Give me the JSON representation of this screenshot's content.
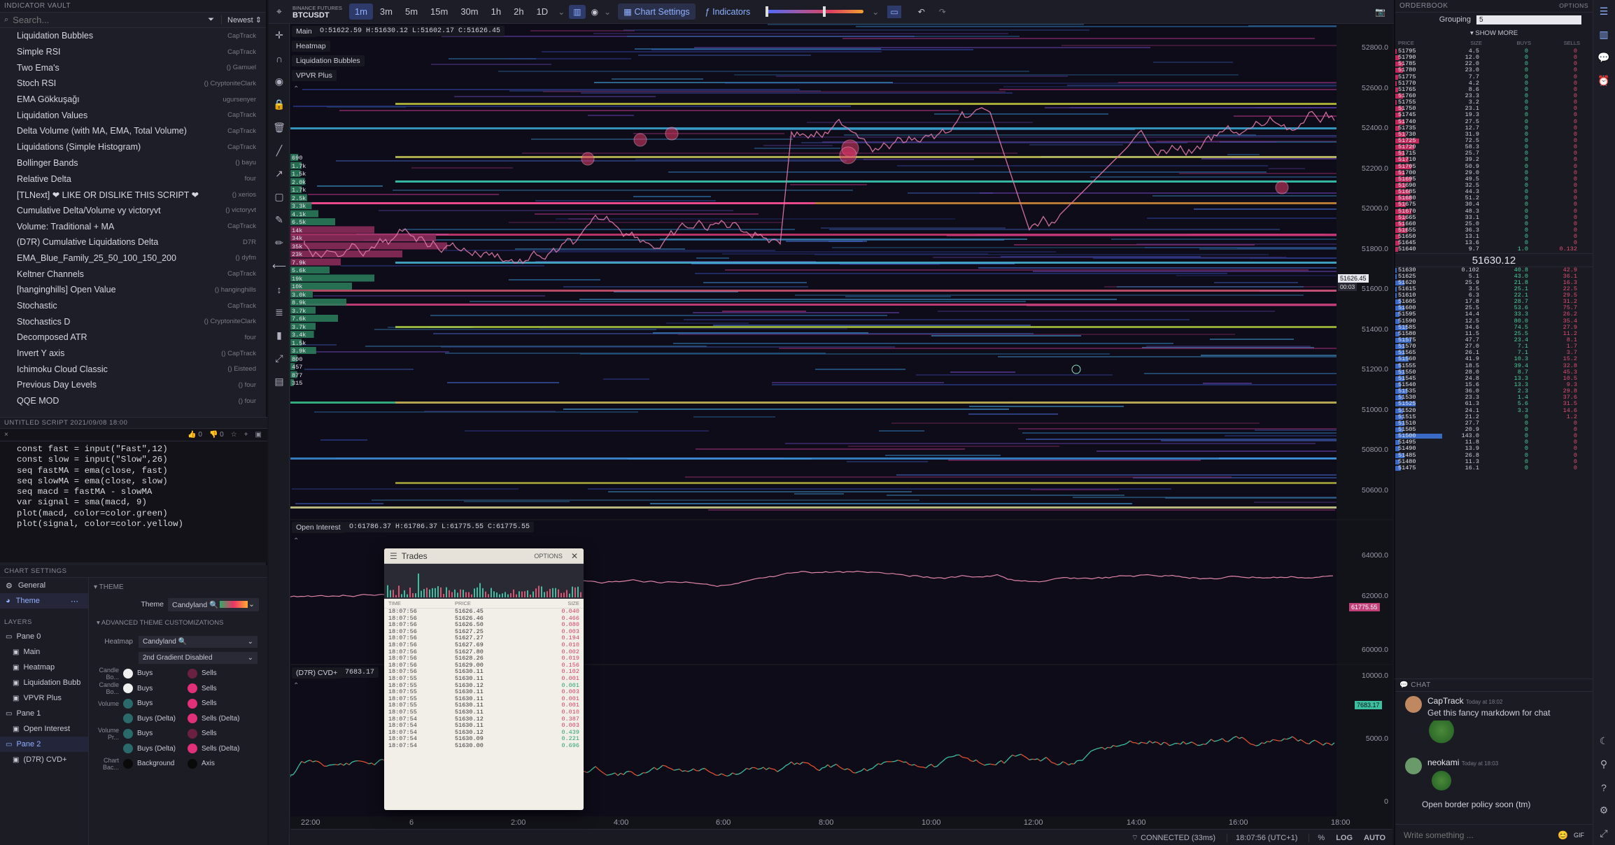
{
  "vault": {
    "title": "INDICATOR VAULT",
    "search_placeholder": "Search...",
    "sort": "Newest",
    "items": [
      {
        "name": "Liquidation Bubbles",
        "author": "CapTrack"
      },
      {
        "name": "Simple RSI",
        "author": "CapTrack"
      },
      {
        "name": "Two Ema's",
        "author": "() Gamuel"
      },
      {
        "name": "Stoch RSI",
        "author": "() CryptoniteClark"
      },
      {
        "name": "EMA Gökkuşağı",
        "author": "ugursenyer"
      },
      {
        "name": "Liquidation Values",
        "author": "CapTrack"
      },
      {
        "name": "Delta Volume (with MA, EMA, Total Volume)",
        "author": "CapTrack"
      },
      {
        "name": "Liquidations (Simple Histogram)",
        "author": "CapTrack"
      },
      {
        "name": "Bollinger Bands",
        "author": "() bayu"
      },
      {
        "name": "Relative Delta",
        "author": "four"
      },
      {
        "name": "[TLNext] ❤ LIKE OR DISLIKE THIS SCRIPT ❤",
        "author": "() xerios"
      },
      {
        "name": "Cumulative Delta/Volume vy victoryvt",
        "author": "() victoryvt"
      },
      {
        "name": "Volume: Traditional + MA",
        "author": "CapTrack"
      },
      {
        "name": "(D7R) Cumulative Liquidations Delta",
        "author": "D7R"
      },
      {
        "name": "EMA_Blue_Family_25_50_100_150_200",
        "author": "() dyfm"
      },
      {
        "name": "Keltner Channels",
        "author": "CapTrack"
      },
      {
        "name": "[hanginghills] Open Value",
        "author": "() hanginghills"
      },
      {
        "name": "Stochastic",
        "author": "CapTrack"
      },
      {
        "name": "Stochastics D",
        "author": "() CryptoniteClark"
      },
      {
        "name": "Decomposed ATR",
        "author": "four"
      },
      {
        "name": "Invert Y axis",
        "author": "() CapTrack"
      },
      {
        "name": "Ichimoku Cloud Classic",
        "author": "() Eisteed"
      },
      {
        "name": "Previous Day Levels",
        "author": "() four"
      },
      {
        "name": "QQE MOD",
        "author": "() four"
      }
    ]
  },
  "editor": {
    "title": "UNTITLED SCRIPT 2021/09/08 18:00",
    "likes": "0",
    "dislikes": "0",
    "lines": [
      "const fast = input(\"Fast\",12)",
      "const slow = input(\"Slow\",26)",
      "",
      "seq fastMA = ema(close, fast)",
      "seq slowMA = ema(close, slow)",
      "",
      "seq macd = fastMA - slowMA",
      "var signal = sma(macd, 9)",
      "",
      "plot(macd, color=color.green)",
      "plot(signal, color=color.yellow)"
    ]
  },
  "settings": {
    "title": "CHART SETTINGS",
    "nav": [
      "General",
      "Theme"
    ],
    "layers_title": "LAYERS",
    "layers": [
      {
        "label": "Pane 0",
        "indent": 0
      },
      {
        "label": "Main",
        "indent": 1
      },
      {
        "label": "Heatmap",
        "indent": 1
      },
      {
        "label": "Liquidation Bubb",
        "indent": 1
      },
      {
        "label": "VPVR Plus",
        "indent": 1
      },
      {
        "label": "Pane 1",
        "indent": 0
      },
      {
        "label": "Open Interest",
        "indent": 1
      },
      {
        "label": "Pane 2",
        "indent": 0
      },
      {
        "label": "(D7R) CVD+",
        "indent": 1
      }
    ],
    "theme_section": "THEME",
    "theme_label": "Theme",
    "theme_value": "Candyland 🔍",
    "adv_section": "ADVANCED THEME CUSTOMIZATIONS",
    "heatmap_label": "Heatmap",
    "heatmap_value": "Candyland 🔍",
    "gradient_value": "2nd Gradient Disabled",
    "rows": [
      {
        "label": "Candle Bo...",
        "a": "Buys",
        "ac": "#f0f0f0",
        "b": "Sells",
        "bc": "#6a2040"
      },
      {
        "label": "Candle Bo...",
        "a": "Buys",
        "ac": "#f0f0f0",
        "b": "Sells",
        "bc": "#e0307a"
      },
      {
        "label": "Volume",
        "a": "Buys",
        "ac": "#2a6a6a",
        "b": "Sells",
        "bc": "#e0307a"
      },
      {
        "label": "",
        "a": "Buys (Delta)",
        "ac": "#2a6a6a",
        "b": "Sells (Delta)",
        "bc": "#e0307a"
      },
      {
        "label": "Volume Pr...",
        "a": "Buys",
        "ac": "#2a6a6a",
        "b": "Sells",
        "bc": "#6a2040"
      },
      {
        "label": "",
        "a": "Buys (Delta)",
        "ac": "#2a6a6a",
        "b": "Sells (Delta)",
        "bc": "#e0307a"
      },
      {
        "label": "Chart Bac...",
        "a": "Background",
        "ac": "#0a0a0a",
        "b": "Axis",
        "bc": "#0a0a0a"
      }
    ]
  },
  "toolbar": {
    "exchange": "BINANCE FUTURES",
    "symbol": "BTCUSDT",
    "timeframes": [
      "1m",
      "3m",
      "5m",
      "15m",
      "30m",
      "1h",
      "2h",
      "1D"
    ],
    "active_tf": "1m",
    "chart_settings": "Chart Settings",
    "indicators": "Indicators"
  },
  "chart": {
    "main_tag": "Main",
    "ohlc": "O:51622.59 H:51630.12 L:51602.17 C:51626.45",
    "overlays": [
      "Heatmap",
      "Liquidation Bubbles",
      "VPVR Plus"
    ],
    "price_labels": [
      "52800.0",
      "52600.0",
      "52400.0",
      "52200.0",
      "52000.0",
      "51800.0",
      "51600.0",
      "51400.0",
      "51200.0",
      "51000.0",
      "50800.0",
      "50600.0"
    ],
    "price_tag": "51626.45",
    "price_tag_sub": "00:03",
    "vpvr_labels": [
      "690",
      "1.7k",
      "1.5k",
      "2.0k",
      "1.7k",
      "2.5k",
      "3.3k",
      "4.1k",
      "6.5k",
      "14k",
      "34k",
      "35k",
      "23k",
      "7.9k",
      "5.6k",
      "19k",
      "10k",
      "3.0k",
      "8.9k",
      "3.7k",
      "7.6k",
      "3.7k",
      "3.4k",
      "1.5k",
      "3.9k",
      "800",
      "457",
      "877",
      "315"
    ]
  },
  "oi": {
    "label": "Open Interest",
    "ohlc": "O:61786.37 H:61786.37 L:61775.55 C:61775.55",
    "labels": [
      "64000.0",
      "62000.0",
      "60000.0"
    ],
    "tag": "61775.55"
  },
  "cvd": {
    "label": "(D7R) CVD+",
    "value": "7683.17",
    "labels": [
      "10000.0",
      "5000.0",
      "0"
    ],
    "tag": "7683.17"
  },
  "xaxis": [
    "22:00",
    "6",
    "2:00",
    "4:00",
    "6:00",
    "8:00",
    "10:00",
    "12:00",
    "14:00",
    "16:00",
    "18:00"
  ],
  "status": {
    "connected": "CONNECTED (33ms)",
    "time": "18:07:56 (UTC+1)",
    "pct": "%",
    "log": "LOG",
    "auto": "AUTO"
  },
  "trades": {
    "title": "Trades",
    "options": "OPTIONS",
    "cols": [
      "TIME",
      "PRICE",
      "SIZE"
    ],
    "rows": [
      [
        "18:07:56",
        "51626.45",
        "0.040",
        "s"
      ],
      [
        "18:07:56",
        "51626.46",
        "0.466",
        "s"
      ],
      [
        "18:07:56",
        "51626.50",
        "0.080",
        "s"
      ],
      [
        "18:07:56",
        "51627.25",
        "0.003",
        "s"
      ],
      [
        "18:07:56",
        "51627.27",
        "0.194",
        "s"
      ],
      [
        "18:07:56",
        "51627.69",
        "0.010",
        "s"
      ],
      [
        "18:07:56",
        "51627.80",
        "0.002",
        "s"
      ],
      [
        "18:07:56",
        "51628.26",
        "0.019",
        "s"
      ],
      [
        "18:07:56",
        "51629.00",
        "0.156",
        "s"
      ],
      [
        "18:07:56",
        "51630.11",
        "0.102",
        "s"
      ],
      [
        "18:07:55",
        "51630.11",
        "0.001",
        "s"
      ],
      [
        "18:07:55",
        "51630.12",
        "0.001",
        "b"
      ],
      [
        "18:07:55",
        "51630.11",
        "0.003",
        "s"
      ],
      [
        "18:07:55",
        "51630.11",
        "0.001",
        "s"
      ],
      [
        "18:07:55",
        "51630.11",
        "0.001",
        "s"
      ],
      [
        "18:07:55",
        "51630.11",
        "0.010",
        "s"
      ],
      [
        "18:07:54",
        "51630.12",
        "0.387",
        "s"
      ],
      [
        "18:07:54",
        "51630.11",
        "0.003",
        "s"
      ],
      [
        "18:07:54",
        "51630.12",
        "0.439",
        "b"
      ],
      [
        "18:07:54",
        "51630.09",
        "0.221",
        "b"
      ],
      [
        "18:07:54",
        "51630.00",
        "0.696",
        "b"
      ]
    ]
  },
  "orderbook": {
    "title": "ORDERBOOK",
    "options": "OPTIONS",
    "grouping_label": "Grouping",
    "grouping_value": "5",
    "show_more": "SHOW MORE",
    "cols": [
      "PRICE",
      "SIZE",
      "BUYS",
      "SELLS"
    ],
    "mid": "51630.12",
    "asks": [
      [
        "51795",
        "4.5",
        "0",
        "0",
        1
      ],
      [
        "51790",
        "12.0",
        "0",
        "0",
        3
      ],
      [
        "51785",
        "22.0",
        "0",
        "0",
        5
      ],
      [
        "51780",
        "23.0",
        "0",
        "0",
        5
      ],
      [
        "51775",
        "7.7",
        "0",
        "0",
        2
      ],
      [
        "51770",
        "4.2",
        "0",
        "0",
        1
      ],
      [
        "51765",
        "8.6",
        "0",
        "0",
        2
      ],
      [
        "51760",
        "23.3",
        "0",
        "0",
        5
      ],
      [
        "51755",
        "3.2",
        "0",
        "0",
        1
      ],
      [
        "51750",
        "23.1",
        "0",
        "0",
        5
      ],
      [
        "51745",
        "19.3",
        "0",
        "0",
        4
      ],
      [
        "51740",
        "27.5",
        "0",
        "0",
        6
      ],
      [
        "51735",
        "12.7",
        "0",
        "0",
        3
      ],
      [
        "51730",
        "31.9",
        "0",
        "0",
        7
      ],
      [
        "51725",
        "72.5",
        "0",
        "0",
        16
      ],
      [
        "51720",
        "58.3",
        "0",
        "0",
        13
      ],
      [
        "51715",
        "25.7",
        "0",
        "0",
        6
      ],
      [
        "51710",
        "39.2",
        "0",
        "0",
        9
      ],
      [
        "51705",
        "50.9",
        "0",
        "0",
        11
      ],
      [
        "51700",
        "29.0",
        "0",
        "0",
        6
      ],
      [
        "51695",
        "49.5",
        "0",
        "0",
        11
      ],
      [
        "51690",
        "32.5",
        "0",
        "0",
        7
      ],
      [
        "51685",
        "44.3",
        "0",
        "0",
        10
      ],
      [
        "51680",
        "51.2",
        "0",
        "0",
        11
      ],
      [
        "51675",
        "30.4",
        "0",
        "0",
        7
      ],
      [
        "51670",
        "48.3",
        "0",
        "0",
        11
      ],
      [
        "51665",
        "33.1",
        "0",
        "0",
        7
      ],
      [
        "51660",
        "25.0",
        "0",
        "0",
        6
      ],
      [
        "51655",
        "36.3",
        "0",
        "0",
        8
      ],
      [
        "51650",
        "13.1",
        "0",
        "0",
        3
      ],
      [
        "51645",
        "13.6",
        "0",
        "0",
        3
      ],
      [
        "51640",
        "9.7",
        "1.0",
        "0.132",
        2
      ]
    ],
    "bids": [
      [
        "51630",
        "0.102",
        "40.8",
        "42.9",
        1
      ],
      [
        "51625",
        "5.1",
        "43.0",
        "36.1",
        1
      ],
      [
        "51620",
        "25.9",
        "21.8",
        "16.3",
        6
      ],
      [
        "51615",
        "3.5",
        "25.1",
        "22.5",
        1
      ],
      [
        "51610",
        "6.3",
        "22.1",
        "29.5",
        1
      ],
      [
        "51605",
        "17.8",
        "28.7",
        "31.2",
        4
      ],
      [
        "51600",
        "25.5",
        "53.6",
        "75.7",
        6
      ],
      [
        "51595",
        "14.4",
        "33.3",
        "26.2",
        3
      ],
      [
        "51590",
        "12.5",
        "80.0",
        "35.4",
        3
      ],
      [
        "51585",
        "34.6",
        "74.5",
        "27.9",
        8
      ],
      [
        "51580",
        "11.5",
        "25.5",
        "11.2",
        3
      ],
      [
        "51575",
        "47.7",
        "23.4",
        "8.1",
        11
      ],
      [
        "51570",
        "27.0",
        "7.1",
        "1.7",
        6
      ],
      [
        "51565",
        "26.1",
        "7.1",
        "3.7",
        6
      ],
      [
        "51560",
        "41.9",
        "10.3",
        "15.2",
        9
      ],
      [
        "51555",
        "18.5",
        "39.4",
        "32.8",
        4
      ],
      [
        "51550",
        "28.0",
        "8.7",
        "45.3",
        6
      ],
      [
        "51545",
        "24.8",
        "13.3",
        "10.5",
        6
      ],
      [
        "51540",
        "15.6",
        "13.3",
        "9.3",
        4
      ],
      [
        "51535",
        "36.0",
        "2.3",
        "29.8",
        8
      ],
      [
        "51530",
        "23.3",
        "1.4",
        "37.6",
        5
      ],
      [
        "51525",
        "61.3",
        "5.6",
        "31.5",
        14
      ],
      [
        "51520",
        "24.1",
        "3.3",
        "14.6",
        5
      ],
      [
        "51515",
        "21.2",
        "0",
        "1.2",
        5
      ],
      [
        "51510",
        "27.7",
        "0",
        "0",
        6
      ],
      [
        "51505",
        "20.9",
        "0",
        "0",
        5
      ],
      [
        "51500",
        "143.0",
        "0",
        "0",
        32
      ],
      [
        "51495",
        "11.8",
        "0",
        "0",
        3
      ],
      [
        "51490",
        "13.9",
        "0",
        "0",
        3
      ],
      [
        "51485",
        "26.8",
        "0",
        "0",
        6
      ],
      [
        "51480",
        "11.3",
        "0",
        "0",
        3
      ],
      [
        "51475",
        "16.1",
        "0",
        "0",
        4
      ]
    ]
  },
  "chat": {
    "title": "CHAT",
    "messages": [
      {
        "user": "CapTrack",
        "time": "Today at 18:02",
        "text": "Get this fancy markdown for chat"
      },
      {
        "user": "neokami",
        "time": "Today at 18:03",
        "text": "Open border policy soon (tm)"
      }
    ],
    "input_placeholder": "Write something ..."
  },
  "colors": {
    "accent": "#5a7dff",
    "bid": "#4a7fd6",
    "ask": "#e03a6a",
    "pink": "#e84a8a",
    "teal": "#3ac0a0"
  }
}
